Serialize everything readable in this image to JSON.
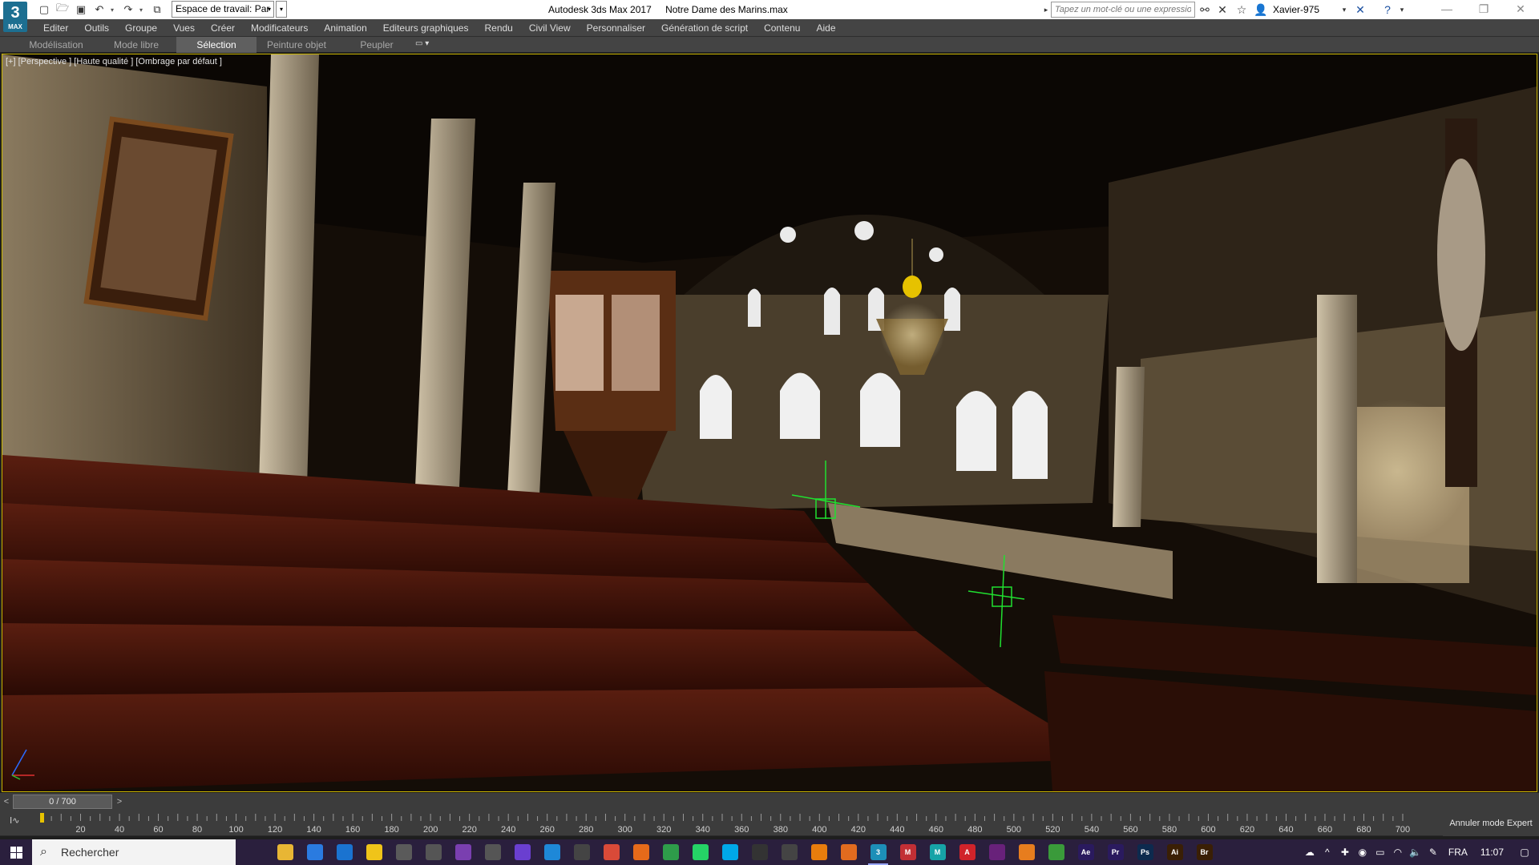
{
  "app": {
    "logo_number": "3",
    "logo_label": "MAX",
    "window_title": "Autodesk 3ds Max 2017",
    "file_name": "Notre Dame des Marins.max"
  },
  "workspace": {
    "label": "Espace de travail: Par"
  },
  "search": {
    "placeholder": "Tapez un mot-clé ou une expression"
  },
  "user": {
    "name": "Xavier-975"
  },
  "menus": [
    "Editer",
    "Outils",
    "Groupe",
    "Vues",
    "Créer",
    "Modificateurs",
    "Animation",
    "Editeurs graphiques",
    "Rendu",
    "Civil View",
    "Personnaliser",
    "Génération de script",
    "Contenu",
    "Aide"
  ],
  "ribbon": {
    "tabs": [
      "Modélisation",
      "Mode libre",
      "Sélection",
      "Peinture objet",
      "Peupler"
    ],
    "active": "Sélection"
  },
  "viewport": {
    "label": "[+] [Perspective ] [Haute qualité ] [Ombrage par défaut ]"
  },
  "timeline": {
    "frame_display": "0 / 700",
    "current_frame": 0,
    "total_frames": 700,
    "ticks": [
      20,
      40,
      60,
      80,
      100,
      120,
      140,
      160,
      180,
      200,
      220,
      240,
      260,
      280,
      300,
      320,
      340,
      360,
      380,
      400,
      420,
      440,
      460,
      480,
      500,
      520,
      540,
      560,
      580,
      600,
      620,
      640,
      660,
      680,
      700
    ],
    "expert_button": "Annuler mode Expert"
  },
  "taskbar": {
    "search_label": "Rechercher",
    "apps": [
      {
        "icon": "task-view-icon",
        "label": "",
        "color": "#2a1f3d"
      },
      {
        "icon": "file-explorer-icon",
        "label": "",
        "color": "#e8b634"
      },
      {
        "icon": "store-icon",
        "label": "",
        "color": "#2a7be0"
      },
      {
        "icon": "mail-icon",
        "label": "",
        "color": "#1a73d0"
      },
      {
        "icon": "sticky-notes-icon",
        "label": "",
        "color": "#f0c419"
      },
      {
        "icon": "media-icon",
        "label": "",
        "color": "#5a5a5a"
      },
      {
        "icon": "calculator-icon",
        "label": "",
        "color": "#555555"
      },
      {
        "icon": "pin-app-icon",
        "label": "",
        "color": "#7a3fb0"
      },
      {
        "icon": "camera-icon",
        "label": "",
        "color": "#555555"
      },
      {
        "icon": "record-icon",
        "label": "",
        "color": "#6a3fd0"
      },
      {
        "icon": "edge-icon",
        "label": "",
        "color": "#1e88d8"
      },
      {
        "icon": "steam-icon",
        "label": "",
        "color": "#444444"
      },
      {
        "icon": "chrome-icon",
        "label": "",
        "color": "#d94a38"
      },
      {
        "icon": "firefox-icon",
        "label": "",
        "color": "#e66a1a"
      },
      {
        "icon": "green-app-icon",
        "label": "",
        "color": "#2e9c4a"
      },
      {
        "icon": "whatsapp-icon",
        "label": "",
        "color": "#25d366"
      },
      {
        "icon": "skype-icon",
        "label": "",
        "color": "#00a8e8"
      },
      {
        "icon": "terminal-icon",
        "label": "",
        "color": "#333333"
      },
      {
        "icon": "unity-icon",
        "label": "",
        "color": "#444444"
      },
      {
        "icon": "blender-icon",
        "label": "",
        "color": "#e87d0d"
      },
      {
        "icon": "fusion-icon",
        "label": "",
        "color": "#e26b1f"
      },
      {
        "icon": "3dsmax-icon",
        "label": "3",
        "color": "#1d8fb8"
      },
      {
        "icon": "motionbuilder-icon",
        "label": "M",
        "color": "#c22f35"
      },
      {
        "icon": "maya-icon",
        "label": "M",
        "color": "#17a3a7"
      },
      {
        "icon": "autocad-icon",
        "label": "A",
        "color": "#d0232a"
      },
      {
        "icon": "visual-studio-icon",
        "label": "",
        "color": "#68217a"
      },
      {
        "icon": "substance-icon",
        "label": "",
        "color": "#e77d1e"
      },
      {
        "icon": "paint-icon",
        "label": "",
        "color": "#3a9a3a"
      },
      {
        "icon": "after-effects-icon",
        "label": "Ae",
        "color": "#2a1a5e"
      },
      {
        "icon": "premiere-icon",
        "label": "Pr",
        "color": "#2a1a5e"
      },
      {
        "icon": "photoshop-icon",
        "label": "Ps",
        "color": "#0d2a4e"
      },
      {
        "icon": "illustrator-icon",
        "label": "Ai",
        "color": "#3a1f05"
      },
      {
        "icon": "bridge-icon",
        "label": "Br",
        "color": "#3a1f05"
      }
    ],
    "language": "FRA",
    "clock": "11:07"
  }
}
